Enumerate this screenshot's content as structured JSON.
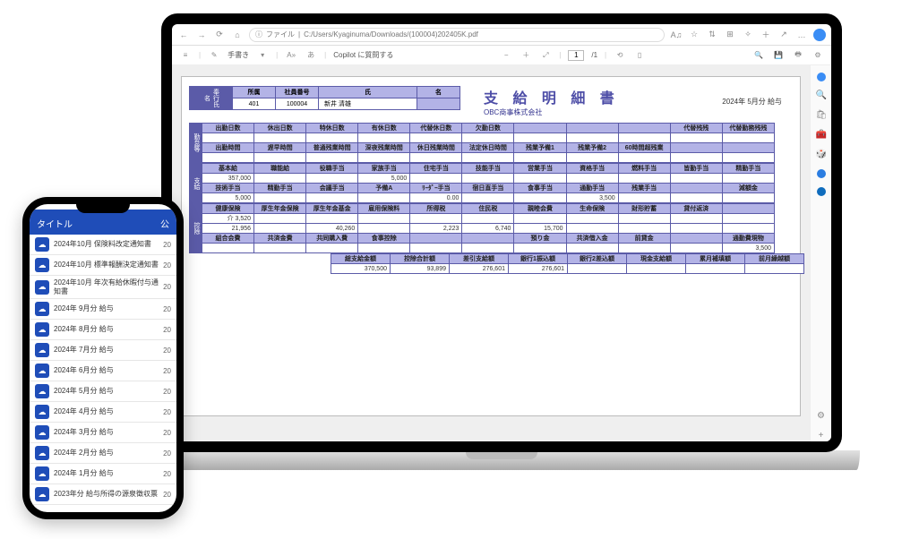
{
  "browser": {
    "url_prefix": "ファイル",
    "url_path": "C:/Users/Kyaginuma/Downloads/(100004)202405K.pdf",
    "copilot_btn": "Copilot に質問する",
    "page_current": "1",
    "page_total": "/1",
    "hand_tool": "手書き",
    "rail_plus": "+"
  },
  "slip": {
    "title": "支 給 明 細 書",
    "company": "OBC商事株式会社",
    "period": "2024年 5月分 給与",
    "emp_headers": [
      "所属",
      "社員番号",
      "氏",
      "名"
    ],
    "emp_values": [
      "401",
      "100004",
      "新井 清雄",
      ""
    ],
    "attendance_tag": "勤怠等",
    "attendance_h1": [
      "出勤日数",
      "休出日数",
      "特休日数",
      "有休日数",
      "代替休日数",
      "欠勤日数",
      "",
      "",
      "",
      "代替残残",
      "代替勤務残残"
    ],
    "attendance_v1": [
      "",
      "",
      "",
      "",
      "",
      "",
      "",
      "",
      "",
      "",
      ""
    ],
    "attendance_h2": [
      "出勤時間",
      "遅早時間",
      "普通残業時間",
      "深夜残業時間",
      "休日残業時間",
      "法定休日時間",
      "残業予備1",
      "残業予備2",
      "60時間超残業",
      "",
      ""
    ],
    "attendance_v2": [
      "",
      "",
      "",
      "",
      "",
      "",
      "",
      "",
      "",
      "",
      ""
    ],
    "pay_tag": "支給",
    "pay_h1": [
      "基本給",
      "職能給",
      "役職手当",
      "家族手当",
      "住宅手当",
      "技能手当",
      "営業手当",
      "資格手当",
      "燃料手当",
      "皆勤手当",
      "精勤手当"
    ],
    "pay_v1": [
      "357,000",
      "",
      "",
      "5,000",
      "",
      "",
      "",
      "",
      "",
      "",
      ""
    ],
    "pay_h2": [
      "技術手当",
      "精勤手当",
      "会議手当",
      "予備A",
      "ﾘｰﾀﾞｰ手当",
      "宿日直手当",
      "食事手当",
      "通勤手当",
      "残業手当",
      "",
      "減額金"
    ],
    "pay_v2": [
      "5,000",
      "",
      "",
      "",
      "0.00",
      "",
      "",
      "3,500",
      "",
      "",
      ""
    ],
    "ded_tag": "控除",
    "ded_h1": [
      "健康保険",
      "厚生年金保険",
      "厚生年金基金",
      "雇用保険料",
      "所得税",
      "住民税",
      "親睦会費",
      "生命保険",
      "財形貯蓄",
      "貸付返済",
      ""
    ],
    "ded_v1a": [
      "介   3,520",
      "",
      "",
      "",
      "",
      "",
      "",
      "",
      "",
      "",
      ""
    ],
    "ded_v1b": [
      "21,956",
      "",
      "40,260",
      "",
      "2,223",
      "6,740",
      "15,700",
      "",
      "",
      "",
      ""
    ],
    "ded_h2": [
      "組合会費",
      "共済金費",
      "共同購入費",
      "食事控除",
      "",
      "",
      "預り金",
      "共済借入金",
      "前貸金",
      "",
      "通勤費現物"
    ],
    "ded_v2": [
      "",
      "",
      "",
      "",
      "",
      "",
      "",
      "",
      "",
      "",
      "3,500"
    ],
    "sum_h": [
      "総支給金額",
      "控除合計額",
      "差引支給額",
      "銀行1振込額",
      "銀行2差込額",
      "現金支給額",
      "累月補填額",
      "前月繰越額"
    ],
    "sum_v": [
      "370,500",
      "93,899",
      "276,601",
      "276,601",
      "",
      "",
      "",
      ""
    ]
  },
  "phone": {
    "header_title": "タイトル",
    "header_pub": "公",
    "items": [
      {
        "label": "2024年10月 保険料改定通知書",
        "yr": "20"
      },
      {
        "label": "2024年10月 標準報酬決定通知書",
        "yr": "20"
      },
      {
        "label": "2024年10月 年次有給休暇付与通知書",
        "yr": "20"
      },
      {
        "label": "2024年 9月分 給与",
        "yr": "20"
      },
      {
        "label": "2024年 8月分 給与",
        "yr": "20"
      },
      {
        "label": "2024年 7月分 給与",
        "yr": "20"
      },
      {
        "label": "2024年 6月分 給与",
        "yr": "20"
      },
      {
        "label": "2024年 5月分 給与",
        "yr": "20"
      },
      {
        "label": "2024年 4月分 給与",
        "yr": "20"
      },
      {
        "label": "2024年 3月分 給与",
        "yr": "20"
      },
      {
        "label": "2024年 2月分 給与",
        "yr": "20"
      },
      {
        "label": "2024年 1月分 給与",
        "yr": "20"
      },
      {
        "label": "2023年分 給与所得の源泉徴収票",
        "yr": "20"
      }
    ]
  }
}
